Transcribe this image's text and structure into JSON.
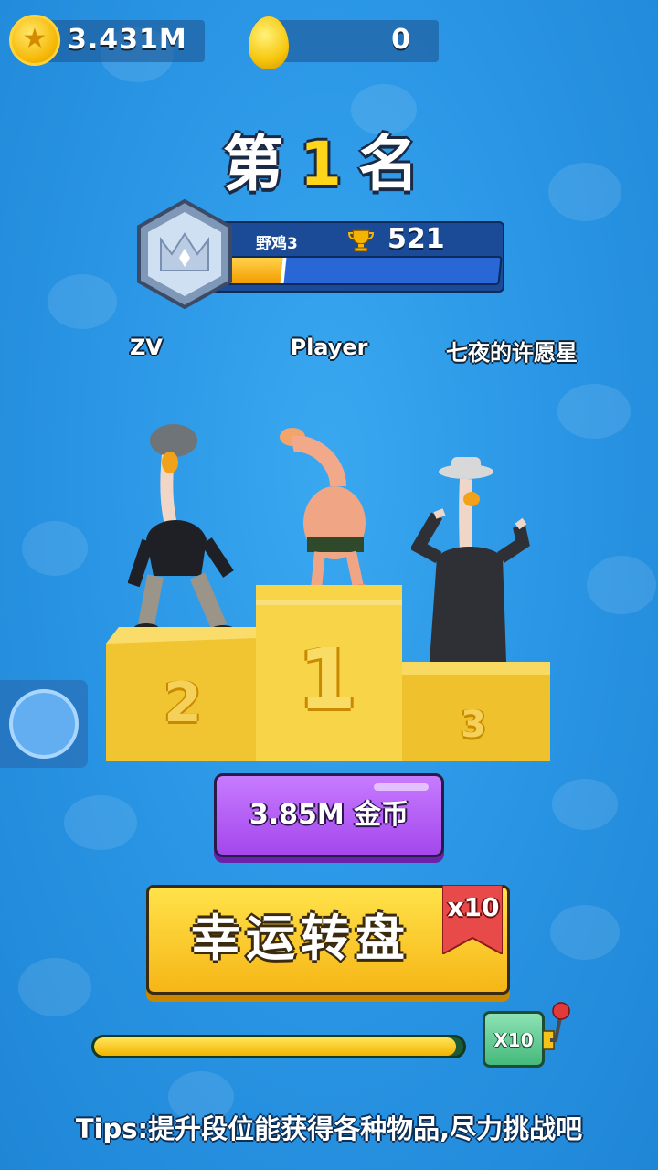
{
  "hud": {
    "coins": "3.431M",
    "eggs": "0"
  },
  "rank": {
    "prefix": "第",
    "number": "1",
    "suffix": "名"
  },
  "progress": {
    "rank_name": "野鸡3",
    "trophies": "521",
    "fill_fraction": 0.2
  },
  "players": {
    "second": "ZV",
    "first": "Player",
    "third": "七夜的许愿星"
  },
  "podium": {
    "second": "2",
    "first": "1",
    "third": "3"
  },
  "reward": {
    "coins_label": "3.85M  金币"
  },
  "wheel": {
    "label": "幸运转盘",
    "multiplier": "x10"
  },
  "bonus": {
    "fill_fraction": 0.98,
    "label": "X10"
  },
  "tips": "Tips:提升段位能获得各种物品,尽力挑战吧",
  "colors": {
    "background": "#2b97e6",
    "gold": "#ffd51a",
    "purple_button": "#b05cf2",
    "yellow_button": "#f8c82a",
    "ribbon": "#e84a4a",
    "green": "#45b97c"
  }
}
